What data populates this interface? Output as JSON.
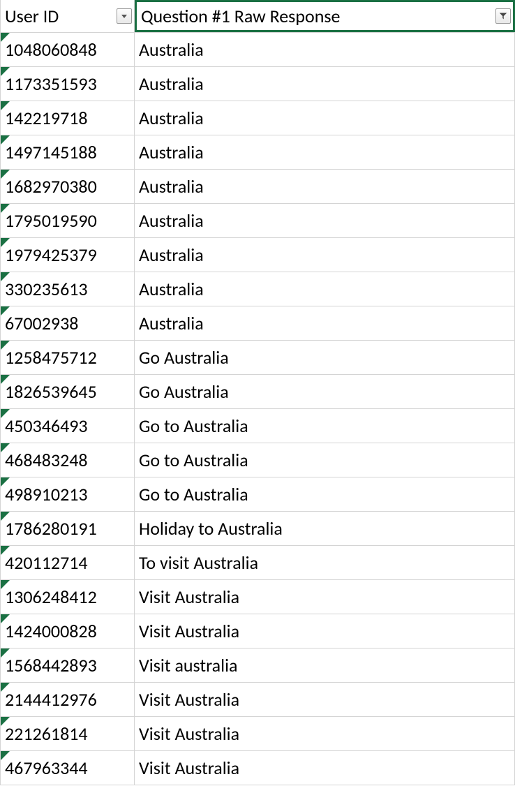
{
  "headers": {
    "col_a": "User ID",
    "col_b": "Question #1 Raw Response"
  },
  "rows": [
    {
      "user_id": "1048060848",
      "response": "Australia"
    },
    {
      "user_id": "1173351593",
      "response": "Australia"
    },
    {
      "user_id": "142219718",
      "response": "Australia"
    },
    {
      "user_id": "1497145188",
      "response": "Australia"
    },
    {
      "user_id": "1682970380",
      "response": "Australia"
    },
    {
      "user_id": "1795019590",
      "response": "Australia"
    },
    {
      "user_id": "1979425379",
      "response": "Australia"
    },
    {
      "user_id": "330235613",
      "response": "Australia"
    },
    {
      "user_id": "67002938",
      "response": "Australia"
    },
    {
      "user_id": "1258475712",
      "response": "Go Australia"
    },
    {
      "user_id": "1826539645",
      "response": "Go Australia"
    },
    {
      "user_id": "450346493",
      "response": "Go to Australia"
    },
    {
      "user_id": "468483248",
      "response": "Go to Australia"
    },
    {
      "user_id": "498910213",
      "response": "Go to Australia"
    },
    {
      "user_id": "1786280191",
      "response": "Holiday to Australia"
    },
    {
      "user_id": "420112714",
      "response": "To visit Australia"
    },
    {
      "user_id": "1306248412",
      "response": "Visit Australia"
    },
    {
      "user_id": "1424000828",
      "response": "Visit Australia"
    },
    {
      "user_id": "1568442893",
      "response": "Visit australia"
    },
    {
      "user_id": "2144412976",
      "response": "Visit Australia"
    },
    {
      "user_id": "221261814",
      "response": "Visit Australia"
    },
    {
      "user_id": "467963344",
      "response": "Visit Australia"
    }
  ]
}
